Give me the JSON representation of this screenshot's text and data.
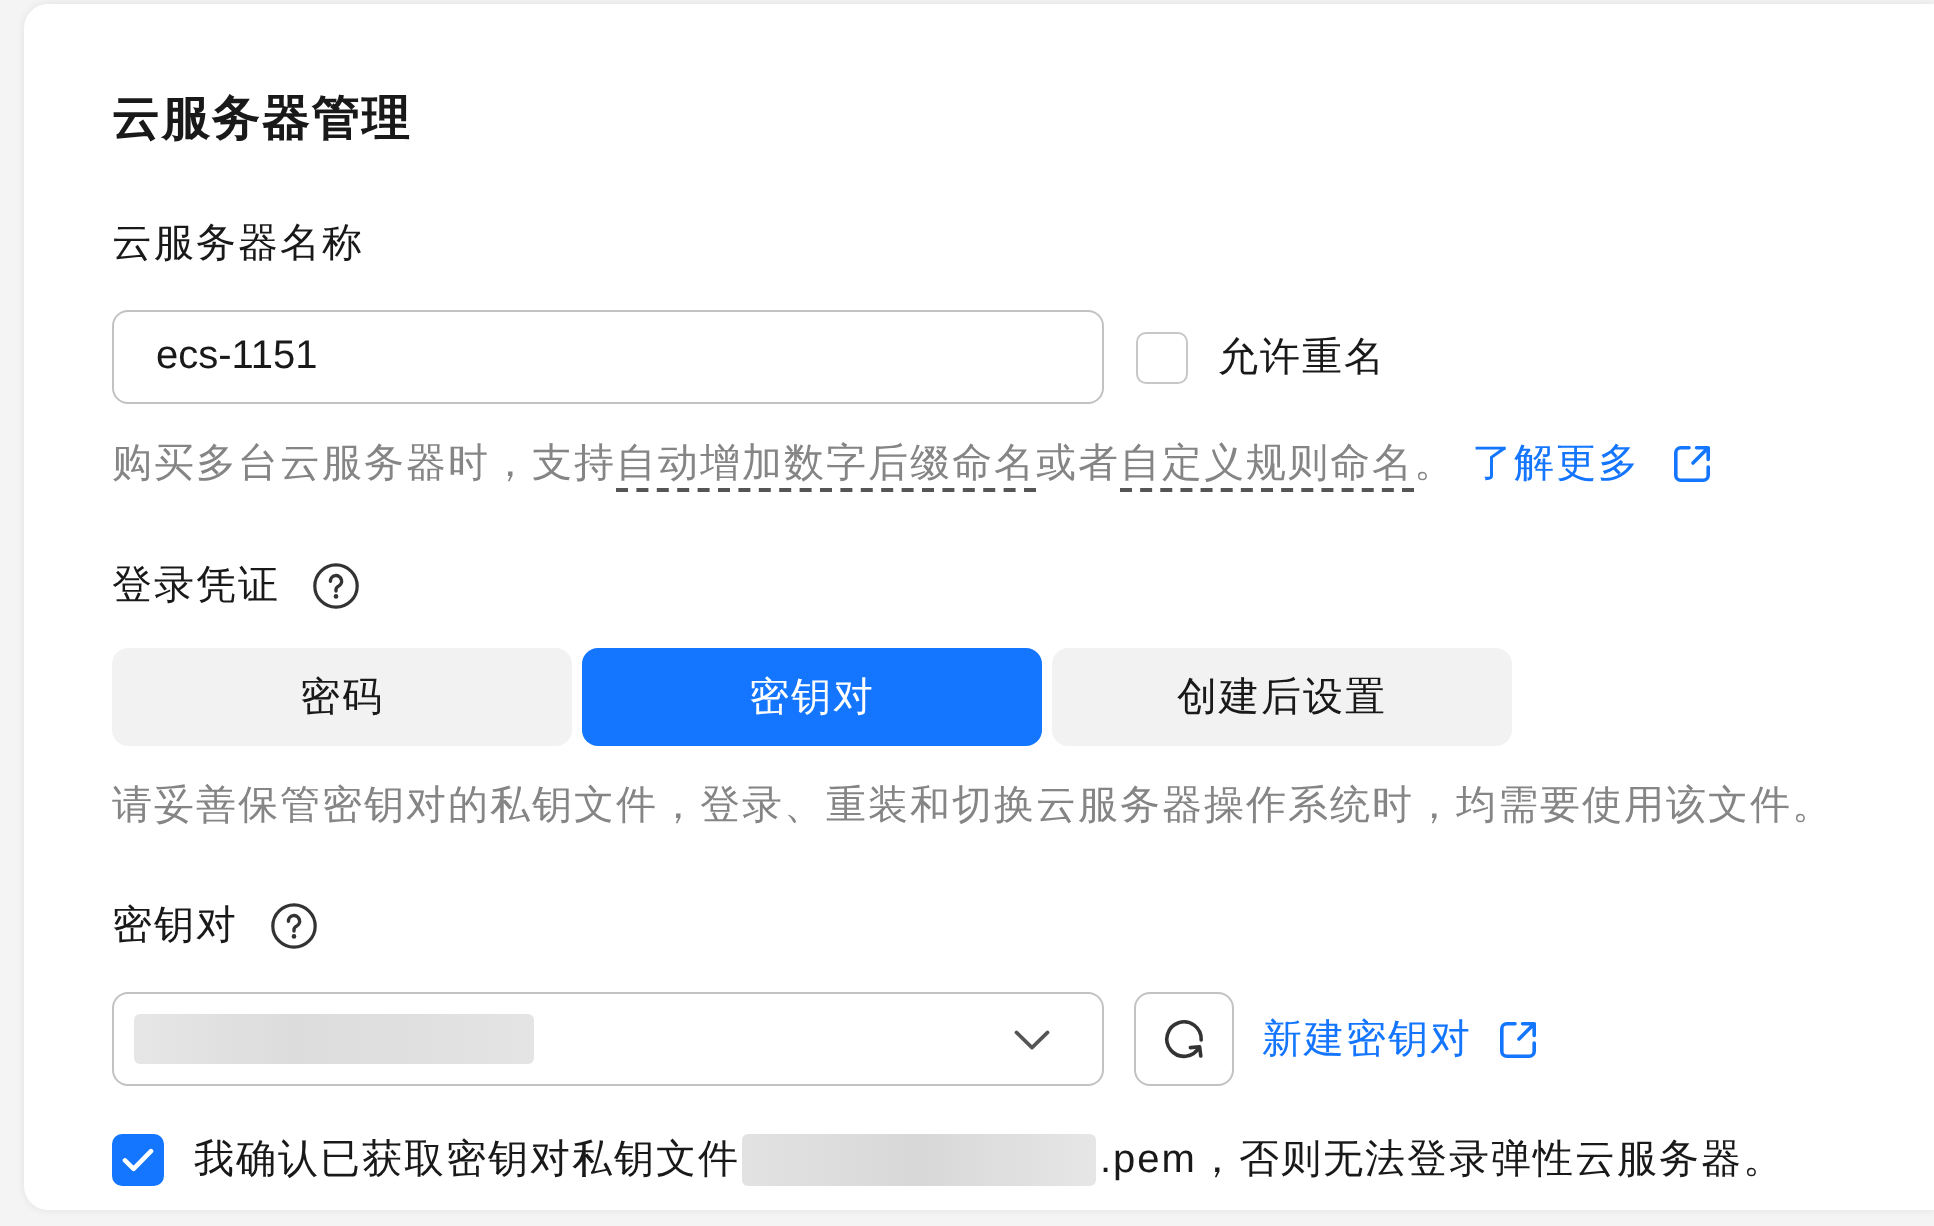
{
  "section": {
    "title": "云服务器管理"
  },
  "server_name": {
    "label": "云服务器名称",
    "value": "ecs-1151",
    "allow_duplicate": {
      "label": "允许重名",
      "checked": false
    },
    "hint": {
      "parts": [
        {
          "text": "购买多台云服务器时，支持",
          "kind": "text"
        },
        {
          "text": "自动增加数字后缀命名",
          "kind": "term"
        },
        {
          "text": "或者",
          "kind": "text"
        },
        {
          "text": "自定义规则命名",
          "kind": "term"
        },
        {
          "text": "。",
          "kind": "text"
        }
      ],
      "link": "了解更多"
    }
  },
  "login_credential": {
    "label": "登录凭证",
    "help": true,
    "tabs": [
      {
        "label": "密码",
        "selected": false
      },
      {
        "label": "密钥对",
        "selected": true
      },
      {
        "label": "创建后设置",
        "selected": false
      }
    ],
    "hint": "请妥善保管密钥对的私钥文件，登录、重装和切换云服务器操作系统时，均需要使用该文件。"
  },
  "key_pair": {
    "label": "密钥对",
    "help": true,
    "select": {
      "value_redacted": true
    },
    "create_link": "新建密钥对",
    "confirm": {
      "checked": true,
      "text_before": "我确认已获取密钥对私钥文件",
      "file_redacted": true,
      "text_after": ".pem，否则无法登录弹性云服务器。"
    }
  }
}
